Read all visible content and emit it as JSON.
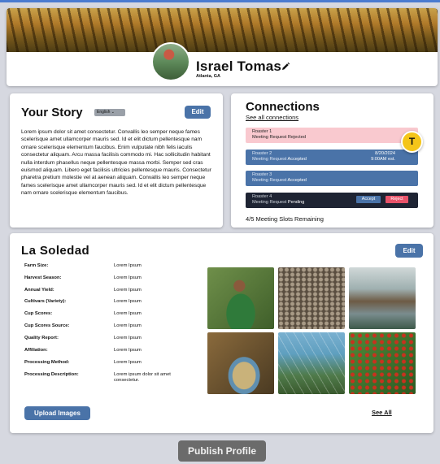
{
  "profile": {
    "name": "Israel Tomas",
    "location": "Atlanta, GA"
  },
  "story": {
    "title": "Your Story",
    "language": "English",
    "edit_label": "Edit",
    "body": "Lorem ipsum dolor sit amet consectetur. Convallis leo semper neque fames scelerisque amet ullamcorper mauris sed. Id et elit dictum pellentesque nam ornare scelerisque elementum faucibus. Enim vulputate nibh felis iaculis consectetur aliquam. Arcu massa facilisis commodo mi. Hac sollicitudin habitant nulla interdum phasellus neque pellentesque massa morbi. Semper sed cras euismod aliquam. Libero eget facilisis ultricies pellentesque mauris. Consectetur pharetra pretium molestie vel at aenean aliquam. Convallis leo semper neque fames scelerisque amet ullamcorper mauris sed. Id et elit dictum pellentesque nam ornare scelerisque elementum faucibus."
  },
  "connections": {
    "title": "Connections",
    "see_all": "See all connections",
    "avatar_letter": "T",
    "items": [
      {
        "name": "Roaster 1",
        "status_prefix": "Meeting Request",
        "status": "Rejected"
      },
      {
        "name": "Roaster 2",
        "status_prefix": "Meeting Request",
        "status": "Accepted",
        "date": "8/20/2024",
        "time": "9:00AM est."
      },
      {
        "name": "Roaster 3",
        "status_prefix": "Meeting Request",
        "status": "Accepted"
      },
      {
        "name": "Roaster 4",
        "status_prefix": "Meeting Request",
        "status": "Pending",
        "accept": "Accept",
        "reject": "Reject"
      }
    ],
    "slots": "4/5 Meeting Slots Remaining"
  },
  "farm": {
    "title": "La Soledad",
    "edit_label": "Edit",
    "fields": [
      {
        "label": "Farm Size:",
        "value": "Lorem Ipsum"
      },
      {
        "label": "Harvest Season:",
        "value": "Lorem Ipsum"
      },
      {
        "label": "Annual Yield:",
        "value": "Lorem Ipsum"
      },
      {
        "label": "Cultivars (Variety):",
        "value": "Lorem Ipsum"
      },
      {
        "label": "Cup Scores:",
        "value": "Lorem Ipsum"
      },
      {
        "label": "Cup Scores Source:",
        "value": "Lorem Ipsum"
      },
      {
        "label": "Quality Report:",
        "value": "Lorem Ipsum"
      },
      {
        "label": "Affiliation:",
        "value": "Lorem Ipsum"
      },
      {
        "label": "Processing Method:",
        "value": "Lorem Ipsum"
      },
      {
        "label": "Processing Description:",
        "value": "Lorem ipsum dolor sit amet consectetur."
      }
    ],
    "upload_label": "Upload Images",
    "see_all": "See All"
  },
  "publish_label": "Publish Profile",
  "colors": {
    "accent": "#4a73a8",
    "rejected": "#f9c9cf",
    "pending": "#1e2433",
    "reject_btn": "#e8536a",
    "avatar_badge": "#f4c51a"
  }
}
